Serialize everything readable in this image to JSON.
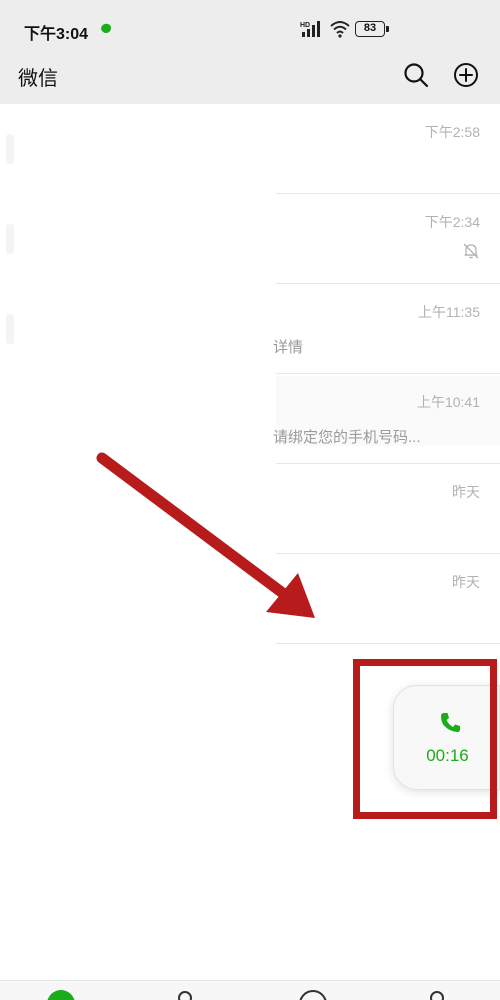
{
  "status_bar": {
    "time": "下午3:04",
    "battery": "83",
    "signal_label": "HD"
  },
  "header": {
    "title": "微信",
    "search_icon": "search-icon",
    "add_icon": "plus-circle-icon"
  },
  "chats": [
    {
      "time": "下午2:58",
      "preview": "",
      "muted": false
    },
    {
      "time": "下午2:34",
      "preview": "",
      "muted": true
    },
    {
      "time": "上午11:35",
      "preview": "详情",
      "muted": false
    },
    {
      "time": "上午10:41",
      "preview": "请绑定您的手机号码...",
      "muted": false
    },
    {
      "time": "昨天",
      "preview": "",
      "muted": false
    },
    {
      "time": "昨天",
      "preview": "",
      "muted": false
    }
  ],
  "floating_call": {
    "duration": "00:16",
    "icon": "phone-icon"
  },
  "colors": {
    "accent_green": "#1aad19",
    "annotation_red": "#b81b1b",
    "header_bg": "#ededed"
  },
  "tab_bar": {
    "icons": [
      "chat-icon",
      "contacts-icon",
      "discover-icon",
      "me-icon"
    ]
  }
}
